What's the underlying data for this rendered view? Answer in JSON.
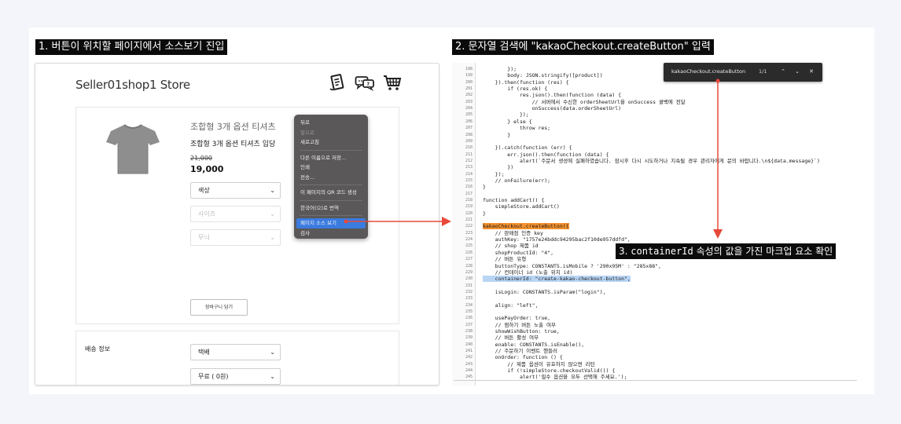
{
  "steps": {
    "step1": "1. 버튼이 위치할 페이지에서 소스보기 진입",
    "step2": "2. 문자열 검색에 \"kakaoCheckout.createButton\" 입력",
    "step3_prefix": "3. ",
    "step3_code": "containerId",
    "step3_suffix": " 속성의 값을 가진 마크업 요소 확인"
  },
  "store": {
    "title": "Seller01shop1 Store",
    "icons": [
      "receipt-icon",
      "chat-icon",
      "cart-icon"
    ],
    "product": {
      "name": "조합형 3개 옵션 티셔츠",
      "description": "조합형 3개 옵션 티셔츠 입당",
      "original_price": "21,000",
      "price": "19,000",
      "options": [
        {
          "label": "색상",
          "disabled": false
        },
        {
          "label": "사이즈",
          "disabled": true
        },
        {
          "label": "무늬",
          "disabled": true
        }
      ],
      "cart_button": "장바구니 담기"
    },
    "shipping": {
      "label": "배송 정보",
      "method": "택배",
      "fee": "무료 ( 0원)"
    }
  },
  "context_menu": {
    "items": [
      {
        "label": "뒤로",
        "state": "normal"
      },
      {
        "label": "앞으로",
        "state": "disabled"
      },
      {
        "label": "새로고침",
        "state": "normal"
      },
      {
        "sep": true
      },
      {
        "label": "다른 이름으로 저장...",
        "state": "normal"
      },
      {
        "label": "인쇄",
        "state": "normal"
      },
      {
        "label": "전송...",
        "state": "normal"
      },
      {
        "sep": true
      },
      {
        "label": "이 페이지의 QR 코드 생성",
        "state": "normal"
      },
      {
        "sep": true
      },
      {
        "label": "한국어(으)로 번역",
        "state": "normal"
      },
      {
        "sep": true
      },
      {
        "label": "페이지 소스 보기",
        "state": "active"
      },
      {
        "label": "검사",
        "state": "normal"
      }
    ]
  },
  "find_bar": {
    "query": "kakaoCheckout.createButton",
    "count": "1/1"
  },
  "source": {
    "first_line": 198,
    "lines": [
      {
        "t": "        });"
      },
      {
        "t": "        body: JSON.stringify([product])"
      },
      {
        "t": "    }).then(function (res) {"
      },
      {
        "t": "        if (res.ok) {"
      },
      {
        "t": "            res.json().then(function (data) {"
      },
      {
        "t": "                // 서버에서 수신한 orderSheetUrl을 onSuccess 콜백에 전달"
      },
      {
        "t": "                onSuccess(data.orderSheetUrl)"
      },
      {
        "t": "            });"
      },
      {
        "t": "        } else {"
      },
      {
        "t": "            throw res;"
      },
      {
        "t": "        }"
      },
      {
        "t": ""
      },
      {
        "t": "    }).catch(function (err) {"
      },
      {
        "t": "        err.json().then(function (data) {"
      },
      {
        "t": "            alert(`주문서 생성에 실패하였습니다. 잠시후 다시 시도하거나 지속될 경우 관리자에게 문의 바랍니다.\\n${data.message}`)"
      },
      {
        "t": "        })"
      },
      {
        "t": "    });"
      },
      {
        "t": "    // onFailure(err);"
      },
      {
        "t": "}"
      },
      {
        "t": ""
      },
      {
        "t": "function addCart() {"
      },
      {
        "t": "    simpleStore.addCart()"
      },
      {
        "t": "}"
      },
      {
        "t": ""
      },
      {
        "t": "kakaoCheckout.createButton({",
        "hl": "orange"
      },
      {
        "t": "    // 판매점 인증 key"
      },
      {
        "t": "    authKey: \"1757e24bddc94295bac2f10de957ddfd\","
      },
      {
        "t": "    // shop 제품 id"
      },
      {
        "t": "    shopProductId: \"4\","
      },
      {
        "t": "    // 버튼 유형"
      },
      {
        "t": "    buttonType: CONSTANTS.isMobile ? '290x95M' : \"285x88\","
      },
      {
        "t": "    // 컨테이너 id (노출 위치 id)"
      },
      {
        "t": "    containerId: \"create-kakao-checkout-button\",",
        "hl": "blue"
      },
      {
        "t": ""
      },
      {
        "t": "    isLogin: CONSTANTS.isParam(\"login\"),"
      },
      {
        "t": ""
      },
      {
        "t": "    align: \"left\","
      },
      {
        "t": ""
      },
      {
        "t": "    usePayOrder: true,"
      },
      {
        "t": "    // 찜하기 버튼 노출 여부"
      },
      {
        "t": "    showWishButton: true,"
      },
      {
        "t": "    // 버튼 활성 여부"
      },
      {
        "t": "    enable: CONSTANTS.isEnable(),"
      },
      {
        "t": "    // 주문하기 이벤트 핸들러"
      },
      {
        "t": "    onOrder: function () {"
      },
      {
        "t": "        // 제품 옵션이 유효하지 않으면 리턴"
      },
      {
        "t": "        if (!simpleStore.checkoutValid()) {"
      },
      {
        "t": "            alert('필수 옵션을 모두 선택해 주세요.');"
      }
    ]
  },
  "colors": {
    "accent_red": "#e8483a",
    "highlight_orange": "#f5922e",
    "highlight_blue": "#b9d5f4",
    "menu_bg": "#5a5858",
    "menu_active": "#3a7be0"
  }
}
